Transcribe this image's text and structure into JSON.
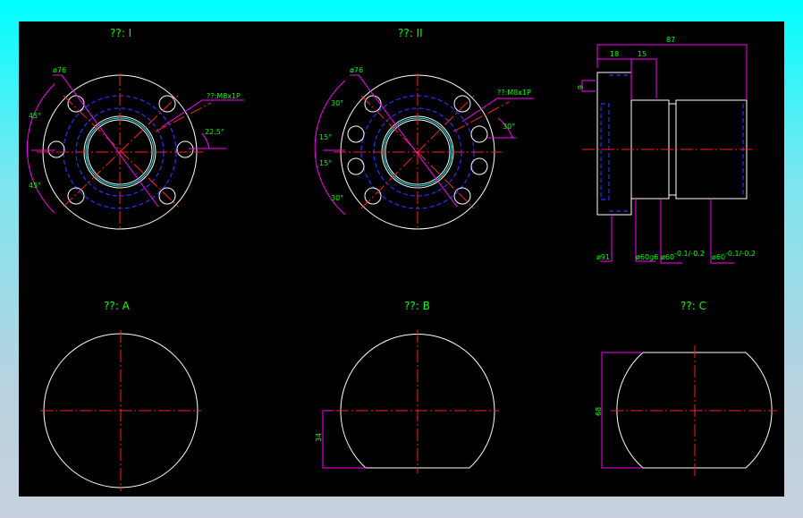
{
  "titles": {
    "view1": "??: I",
    "view2": "??: II",
    "viewA": "??: A",
    "viewB": "??: B",
    "viewC": "??: C"
  },
  "dims": {
    "v1_d76": "ø76",
    "v1_thread": "??:M8x1P",
    "v1_a45_top": "45°",
    "v1_a45_bot": "45°",
    "v1_a22": "22.5°",
    "v2_d76": "ø76",
    "v2_thread": "??:M8x1P",
    "v2_a30_tl": "30°",
    "v2_a15_t": "15°",
    "v2_a15_b": "15°",
    "v2_a30_bl": "30°",
    "v2_a30_r": "30°",
    "side_87": "87",
    "side_18": "18",
    "side_15": "15",
    "side_9": "9",
    "side_d91": "ø91",
    "side_d60g6": "ø60g6",
    "side_d60a": "ø60",
    "side_d60a_tol": "-0.1/-0.2",
    "side_d60b": "ø60",
    "side_d60b_tol": "-0.1/-0.2",
    "b_34": "34",
    "c_68": "68"
  },
  "colors": {
    "background": "#000000",
    "geometry": "#ffffff",
    "centerline": "#ff2020",
    "hidden": "#3030ff",
    "dimension": "#ff00ff",
    "text": "#00ff00"
  }
}
